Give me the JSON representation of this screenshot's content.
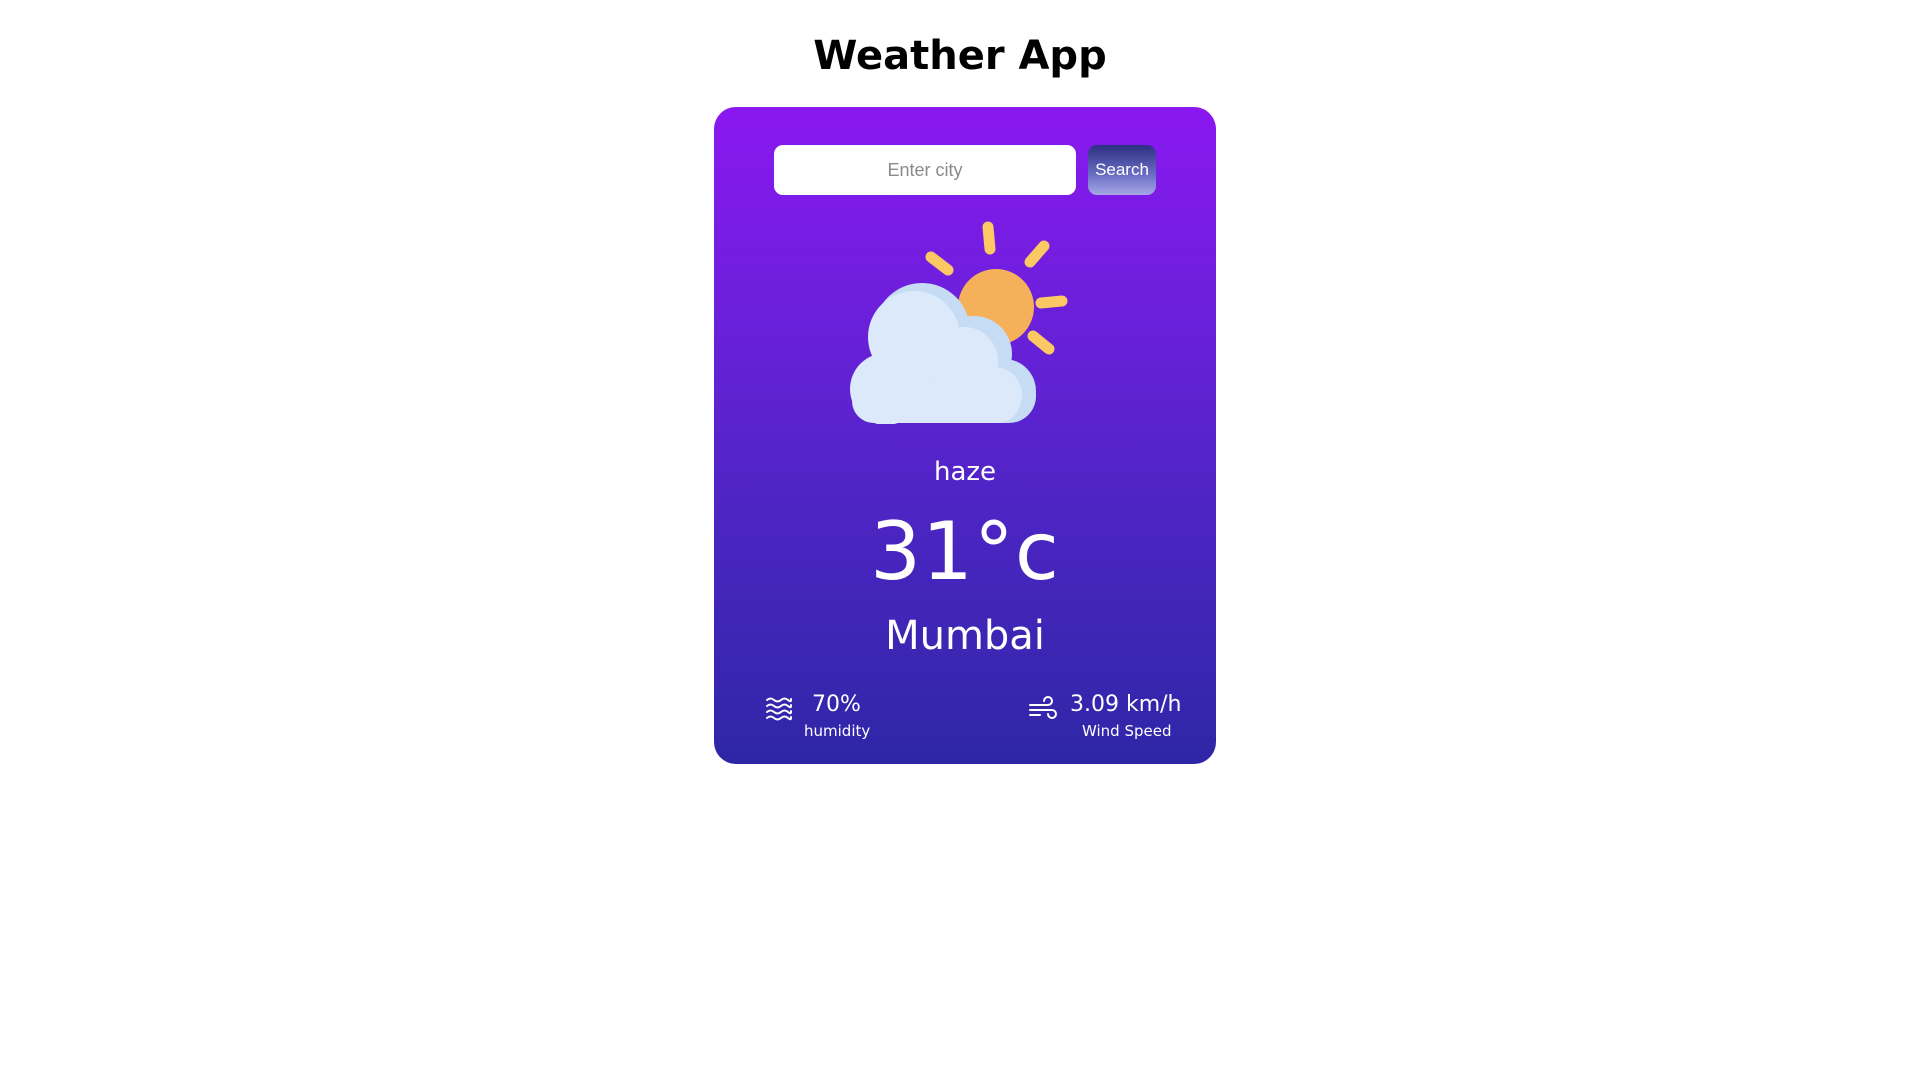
{
  "header": {
    "title": "Weather App"
  },
  "search": {
    "placeholder": "Enter city",
    "value": "",
    "button_label": "Search"
  },
  "weather": {
    "icon": "cloud-sun-icon",
    "condition": "haze",
    "temperature": "31°c",
    "city": "Mumbai"
  },
  "details": {
    "humidity": {
      "icon": "humidity-waves-icon",
      "value": "70%",
      "label": "humidity"
    },
    "wind": {
      "icon": "wind-icon",
      "value": "3.09 km/h",
      "label": "Wind Speed"
    }
  },
  "colors": {
    "card_gradient_top": "#8a18f0",
    "card_gradient_bottom": "#2e26a6",
    "sun": "#f5b05a",
    "sun_rays": "#fbc864",
    "cloud": "#dbe9fb"
  }
}
